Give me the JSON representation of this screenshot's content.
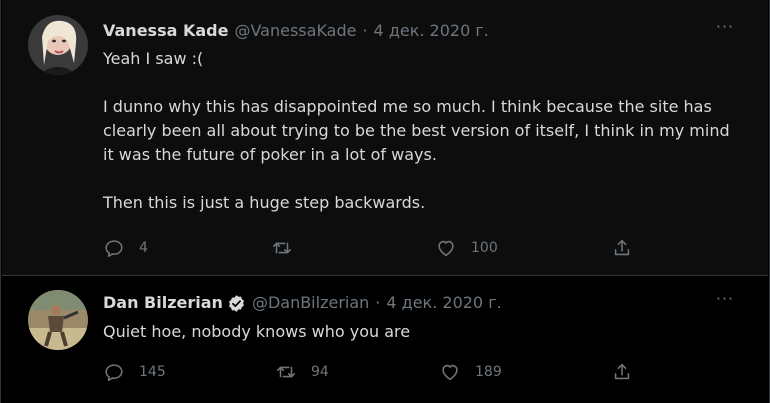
{
  "tweets": [
    {
      "name": "Vanessa Kade",
      "handle": "@VanessaKade",
      "separator": "·",
      "date": "4 дек. 2020 г.",
      "more": "···",
      "lines": [
        "Yeah I saw :(",
        "",
        "I dunno why this has disappointed me so much. I think because the site has clearly been all about trying to be the best version of itself, I think in my mind it was the future of poker in a lot of ways.",
        "",
        "Then this is just a huge step backwards."
      ],
      "replies": "4",
      "retweets": "",
      "likes": "100"
    },
    {
      "name": "Dan Bilzerian",
      "verified": true,
      "handle": "@DanBilzerian",
      "separator": "·",
      "date": "4 дек. 2020 г.",
      "more": "···",
      "lines": [
        "Quiet hoe, nobody knows who you are"
      ],
      "replies": "145",
      "retweets": "94",
      "likes": "189"
    }
  ],
  "colors": {
    "background": "#000000",
    "text": "#d9d9d9",
    "muted": "#6e767d",
    "verified": "#d9d9d9"
  },
  "icons": [
    "reply-icon",
    "retweet-icon",
    "like-icon",
    "share-icon",
    "more-icon",
    "verified-icon"
  ]
}
